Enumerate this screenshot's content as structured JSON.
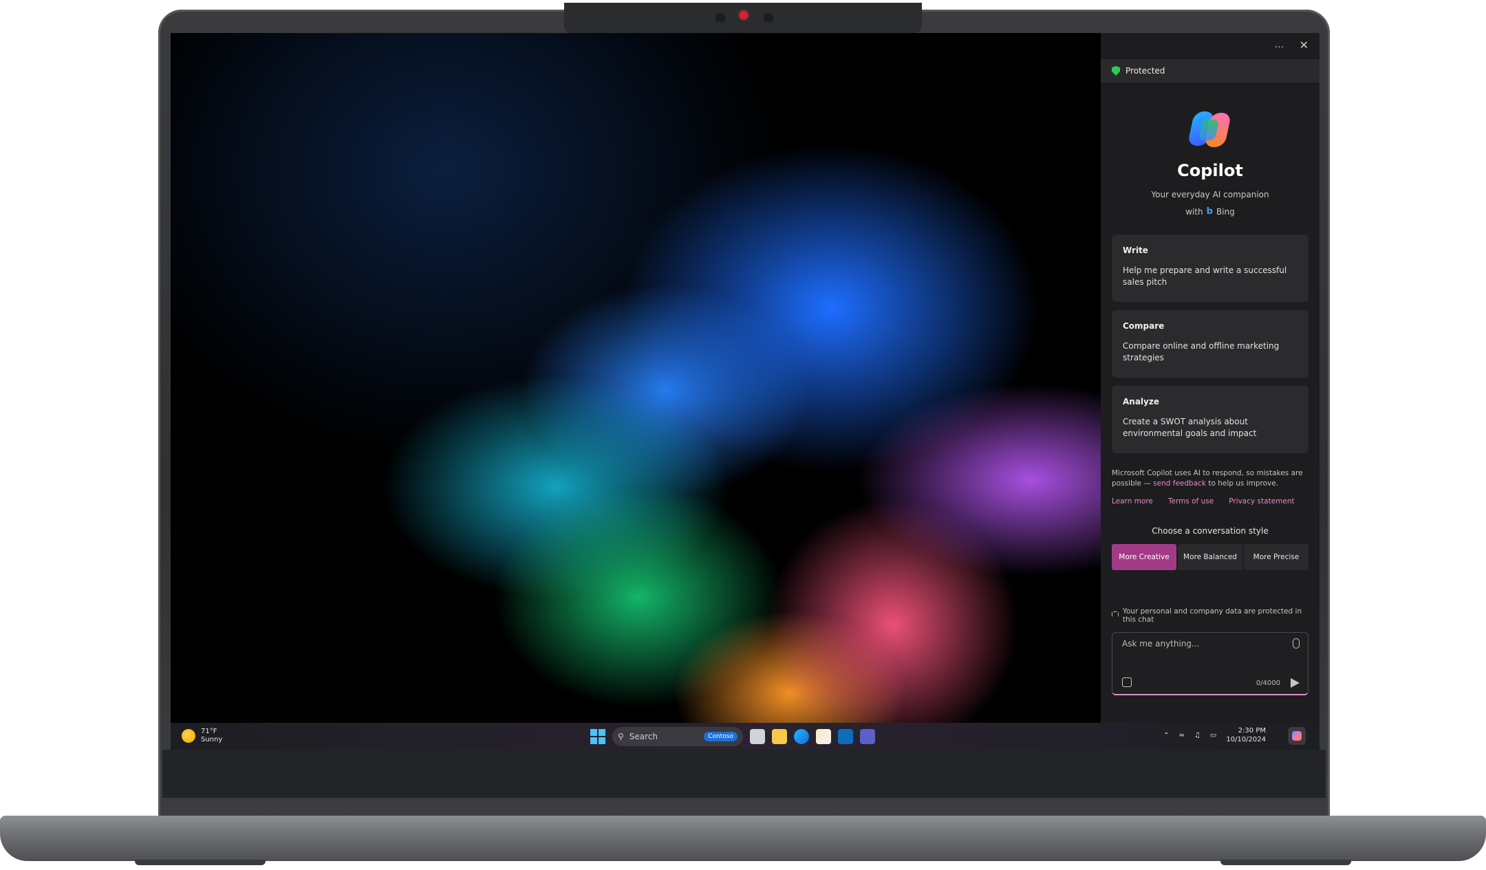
{
  "copilot": {
    "more_label": "...",
    "close_label": "✕",
    "protected_label": "Protected",
    "title": "Copilot",
    "subtitle": "Your everyday AI companion",
    "with_label": "with",
    "bing_label": "Bing",
    "cards": [
      {
        "heading": "Write",
        "description": "Help me prepare and write a successful sales pitch"
      },
      {
        "heading": "Compare",
        "description": "Compare online and offline marketing strategies"
      },
      {
        "heading": "Analyze",
        "description": "Create a SWOT analysis about environmental goals and impact"
      }
    ],
    "disclaimer_text": "Microsoft Copilot uses AI to respond, so mistakes are possible —",
    "feedback_link": "send feedback",
    "disclaimer_tail": "to help us improve.",
    "links": [
      "Learn more",
      "Terms of use",
      "Privacy statement"
    ],
    "style_label": "Choose a conversation style",
    "styles": [
      "More Creative",
      "More Balanced",
      "More Precise"
    ],
    "selected_style": "More Creative",
    "privacy_note": "Your personal and company data are protected in this chat",
    "input_placeholder": "Ask me anything...",
    "counter": "0/4000"
  },
  "taskbar": {
    "weather_temp": "71°F",
    "weather_condition": "Sunny",
    "search_label": "Search",
    "search_pill": "Contoso",
    "time": "2:30 PM",
    "date": "10/10/2024",
    "pinned_apps": [
      "file-explorer-icon",
      "folder-icon",
      "edge-icon",
      "store-icon",
      "outlook-icon",
      "teams-icon"
    ]
  },
  "colors": {
    "accent_pink": "#a33a88",
    "link_pink": "#e58bc6",
    "protected_green": "#2ecc55",
    "taskbar_bg": "#1d1e23",
    "pane_bg": "#1d1d1f"
  }
}
